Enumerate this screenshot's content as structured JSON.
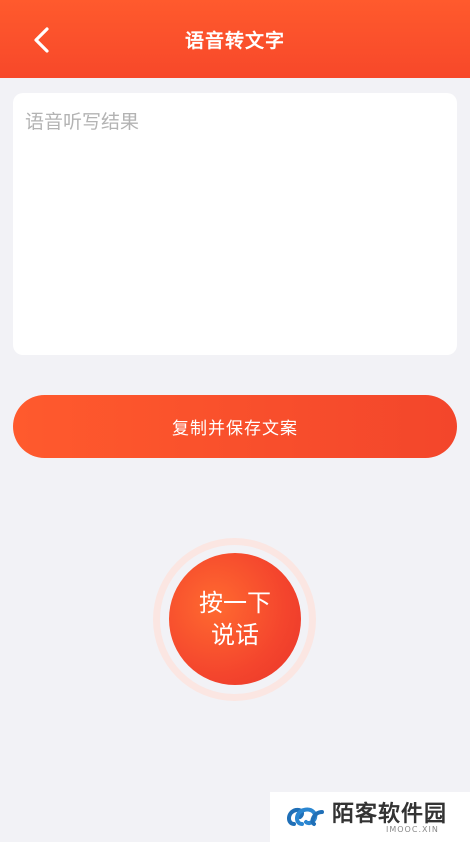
{
  "header": {
    "title": "语音转文字",
    "back_icon": "chevron-left-icon"
  },
  "result": {
    "placeholder": "语音听写结果",
    "value": ""
  },
  "actions": {
    "copy_save_label": "复制并保存文案"
  },
  "talk": {
    "line1": "按一下",
    "line2": "说话"
  },
  "watermark": {
    "name": "陌客软件园",
    "sub": "IMOOC.XIN"
  },
  "colors": {
    "accent": "#f7482a",
    "background": "#f2f2f6"
  }
}
